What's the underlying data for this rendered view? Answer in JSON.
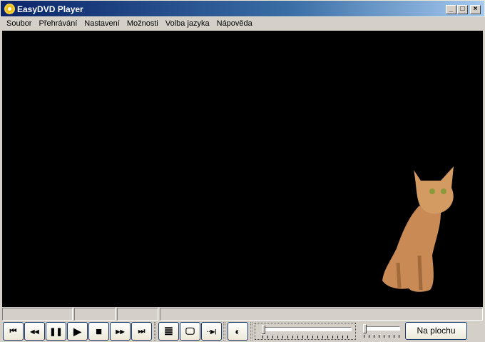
{
  "window": {
    "title": "EasyDVD Player",
    "minimize": "_",
    "maximize": "□",
    "close": "×"
  },
  "menu": [
    "Soubor",
    "Přehrávání",
    "Nastavení",
    "Možnosti",
    "Volba jazyka",
    "Nápověda"
  ],
  "controls": [
    {
      "name": "previous-chapter",
      "glyph": "⏮"
    },
    {
      "name": "rewind",
      "glyph": "◀◀"
    },
    {
      "name": "pause",
      "glyph": "❚❚"
    },
    {
      "name": "play",
      "glyph": "▶"
    },
    {
      "name": "stop",
      "glyph": "■"
    },
    {
      "name": "fast-forward",
      "glyph": "▶▶"
    },
    {
      "name": "next-chapter",
      "glyph": "⏭"
    },
    {
      "name": "playlist",
      "glyph": "≣"
    },
    {
      "name": "display",
      "glyph": "🖵"
    },
    {
      "name": "step-frame",
      "glyph": "··▶|"
    },
    {
      "name": "brightness",
      "glyph": "◐"
    }
  ],
  "position_slider": {
    "value": 0
  },
  "volume_slider": {
    "value": 0
  },
  "desktop_button": "Na plochu"
}
